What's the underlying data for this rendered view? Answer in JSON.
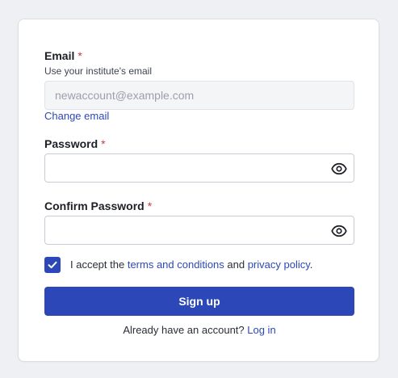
{
  "email": {
    "label": "Email",
    "required_mark": "*",
    "hint": "Use your institute's email",
    "value": "newaccount@example.com",
    "change_link": "Change email"
  },
  "password": {
    "label": "Password",
    "required_mark": "*",
    "value": "",
    "toggle_icon": "eye-icon"
  },
  "confirm_password": {
    "label": "Confirm Password",
    "required_mark": "*",
    "value": "",
    "toggle_icon": "eye-icon"
  },
  "terms": {
    "checked": true,
    "prefix": "I accept the ",
    "terms_link": "terms and conditions",
    "middle": " and ",
    "privacy_link": "privacy policy",
    "suffix": "."
  },
  "submit": {
    "label": "Sign up"
  },
  "footer": {
    "text": "Already have an account? ",
    "login_link": "Log in"
  },
  "colors": {
    "accent": "#2c48b8",
    "required": "#d03a3a",
    "background": "#eff0f3"
  }
}
